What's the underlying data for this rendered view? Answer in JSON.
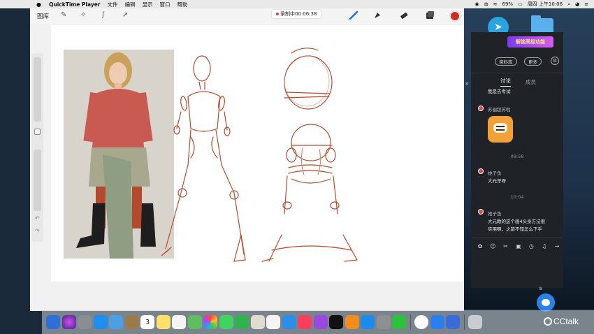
{
  "menubar": {
    "app_name": "QuickTime Player",
    "menus": [
      "文件",
      "编辑",
      "显示",
      "窗口",
      "帮助"
    ],
    "battery": "69%",
    "clock": "周四 上午10:06"
  },
  "procreate": {
    "gallery_label": "图库",
    "recording_label": "录制中00:06:38",
    "active_color": "#d12d1c"
  },
  "chat": {
    "promo_label": "解锁高级功能",
    "btn_materials": "资料库",
    "btn_more": "更多",
    "tab_discussion": "讨论",
    "tab_members": "成员",
    "side_number": "8",
    "messages": [
      {
        "text": "我是去考试"
      },
      {
        "user": "苏幽超苏啦"
      },
      {
        "time": "09:58"
      },
      {
        "user": "她子鱼",
        "text": "大元早呀"
      },
      {
        "time": "10:04"
      },
      {
        "user": "她子鱼",
        "text_line1": "大元教的这个画4头身方法很",
        "text_line2": "实用啊，之前不知怎么下手"
      }
    ]
  },
  "desktop": {
    "small_label": "b"
  },
  "dock": {
    "calendar_day": "3",
    "brand": "CCtalk"
  }
}
